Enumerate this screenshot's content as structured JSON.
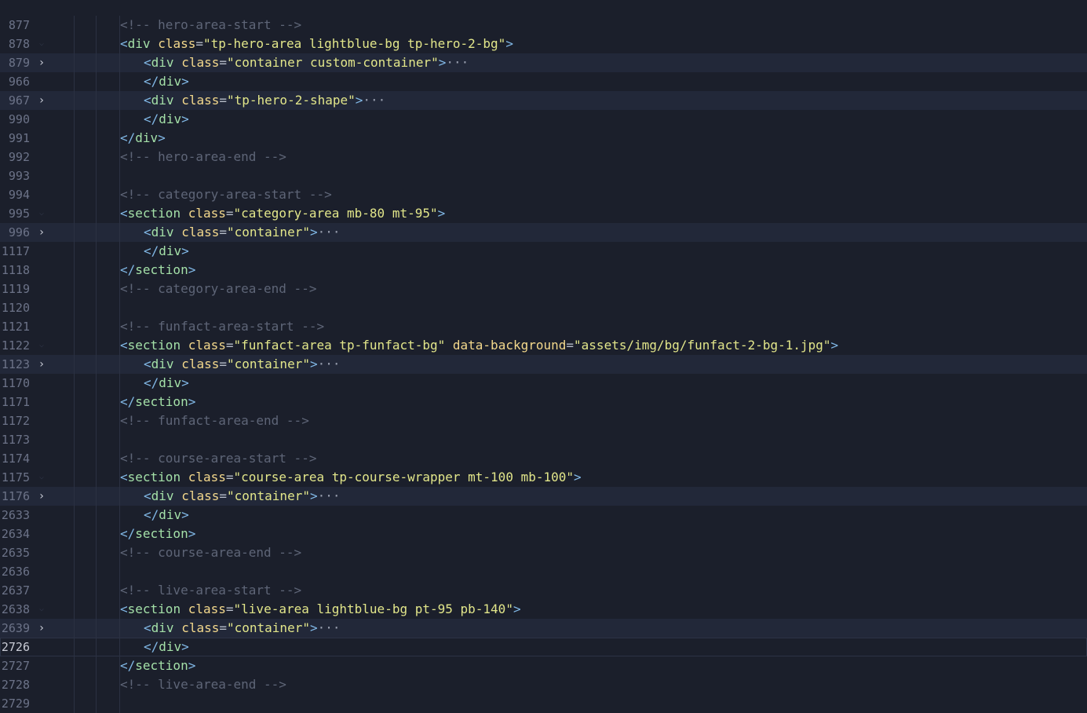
{
  "editor": {
    "lines": [
      {
        "num": "",
        "fold": "",
        "indent": 0,
        "tokens": []
      },
      {
        "num": "877",
        "fold": "",
        "indent": 3,
        "tokens": [
          {
            "c": "c",
            "t": "<!-- hero-area-start -->"
          }
        ]
      },
      {
        "num": "878",
        "fold": "open",
        "indent": 3,
        "tokens": [
          {
            "c": "b",
            "t": "<"
          },
          {
            "c": "t",
            "t": "div"
          },
          {
            "c": "p",
            "t": " "
          },
          {
            "c": "a",
            "t": "class"
          },
          {
            "c": "p",
            "t": "="
          },
          {
            "c": "s",
            "t": "\"tp-hero-area lightblue-bg tp-hero-2-bg\""
          },
          {
            "c": "b",
            "t": ">"
          }
        ]
      },
      {
        "num": "879",
        "fold": "closed",
        "indent": 4,
        "tokens": [
          {
            "c": "b",
            "t": "<"
          },
          {
            "c": "t",
            "t": "div"
          },
          {
            "c": "p",
            "t": " "
          },
          {
            "c": "a",
            "t": "class"
          },
          {
            "c": "p",
            "t": "="
          },
          {
            "c": "s",
            "t": "\"container custom-container\""
          },
          {
            "c": "b",
            "t": ">"
          },
          {
            "c": "el",
            "t": "···"
          }
        ]
      },
      {
        "num": "966",
        "fold": "",
        "indent": 4,
        "tokens": [
          {
            "c": "b",
            "t": "</"
          },
          {
            "c": "t",
            "t": "div"
          },
          {
            "c": "b",
            "t": ">"
          }
        ]
      },
      {
        "num": "967",
        "fold": "closed",
        "indent": 4,
        "tokens": [
          {
            "c": "b",
            "t": "<"
          },
          {
            "c": "t",
            "t": "div"
          },
          {
            "c": "p",
            "t": " "
          },
          {
            "c": "a",
            "t": "class"
          },
          {
            "c": "p",
            "t": "="
          },
          {
            "c": "s",
            "t": "\"tp-hero-2-shape\""
          },
          {
            "c": "b",
            "t": ">"
          },
          {
            "c": "el",
            "t": "···"
          }
        ]
      },
      {
        "num": "990",
        "fold": "",
        "indent": 4,
        "tokens": [
          {
            "c": "b",
            "t": "</"
          },
          {
            "c": "t",
            "t": "div"
          },
          {
            "c": "b",
            "t": ">"
          }
        ]
      },
      {
        "num": "991",
        "fold": "",
        "indent": 3,
        "tokens": [
          {
            "c": "b",
            "t": "</"
          },
          {
            "c": "t",
            "t": "div"
          },
          {
            "c": "b",
            "t": ">"
          }
        ]
      },
      {
        "num": "992",
        "fold": "",
        "indent": 3,
        "tokens": [
          {
            "c": "c",
            "t": "<!-- hero-area-end -->"
          }
        ]
      },
      {
        "num": "993",
        "fold": "",
        "indent": 3,
        "tokens": []
      },
      {
        "num": "994",
        "fold": "",
        "indent": 3,
        "tokens": [
          {
            "c": "c",
            "t": "<!-- category-area-start -->"
          }
        ]
      },
      {
        "num": "995",
        "fold": "open",
        "indent": 3,
        "tokens": [
          {
            "c": "b",
            "t": "<"
          },
          {
            "c": "t",
            "t": "section"
          },
          {
            "c": "p",
            "t": " "
          },
          {
            "c": "a",
            "t": "class"
          },
          {
            "c": "p",
            "t": "="
          },
          {
            "c": "s",
            "t": "\"category-area mb-80 mt-95\""
          },
          {
            "c": "b",
            "t": ">"
          }
        ]
      },
      {
        "num": "996",
        "fold": "closed",
        "indent": 4,
        "tokens": [
          {
            "c": "b",
            "t": "<"
          },
          {
            "c": "t",
            "t": "div"
          },
          {
            "c": "p",
            "t": " "
          },
          {
            "c": "a",
            "t": "class"
          },
          {
            "c": "p",
            "t": "="
          },
          {
            "c": "s",
            "t": "\"container\""
          },
          {
            "c": "b",
            "t": ">"
          },
          {
            "c": "el",
            "t": "···"
          }
        ]
      },
      {
        "num": "1117",
        "fold": "",
        "indent": 4,
        "tokens": [
          {
            "c": "b",
            "t": "</"
          },
          {
            "c": "t",
            "t": "div"
          },
          {
            "c": "b",
            "t": ">"
          }
        ]
      },
      {
        "num": "1118",
        "fold": "",
        "indent": 3,
        "tokens": [
          {
            "c": "b",
            "t": "</"
          },
          {
            "c": "t",
            "t": "section"
          },
          {
            "c": "b",
            "t": ">"
          }
        ]
      },
      {
        "num": "1119",
        "fold": "",
        "indent": 3,
        "tokens": [
          {
            "c": "c",
            "t": "<!-- category-area-end -->"
          }
        ]
      },
      {
        "num": "1120",
        "fold": "",
        "indent": 3,
        "tokens": []
      },
      {
        "num": "1121",
        "fold": "",
        "indent": 3,
        "tokens": [
          {
            "c": "c",
            "t": "<!-- funfact-area-start -->"
          }
        ]
      },
      {
        "num": "1122",
        "fold": "open",
        "indent": 3,
        "tokens": [
          {
            "c": "b",
            "t": "<"
          },
          {
            "c": "t",
            "t": "section"
          },
          {
            "c": "p",
            "t": " "
          },
          {
            "c": "a",
            "t": "class"
          },
          {
            "c": "p",
            "t": "="
          },
          {
            "c": "s",
            "t": "\"funfact-area tp-funfact-bg\""
          },
          {
            "c": "p",
            "t": " "
          },
          {
            "c": "a",
            "t": "data-background"
          },
          {
            "c": "p",
            "t": "="
          },
          {
            "c": "s",
            "t": "\"assets/img/bg/funfact-2-bg-1.jpg\""
          },
          {
            "c": "b",
            "t": ">"
          }
        ]
      },
      {
        "num": "1123",
        "fold": "closed",
        "indent": 4,
        "tokens": [
          {
            "c": "b",
            "t": "<"
          },
          {
            "c": "t",
            "t": "div"
          },
          {
            "c": "p",
            "t": " "
          },
          {
            "c": "a",
            "t": "class"
          },
          {
            "c": "p",
            "t": "="
          },
          {
            "c": "s",
            "t": "\"container\""
          },
          {
            "c": "b",
            "t": ">"
          },
          {
            "c": "el",
            "t": "···"
          }
        ]
      },
      {
        "num": "1170",
        "fold": "",
        "indent": 4,
        "tokens": [
          {
            "c": "b",
            "t": "</"
          },
          {
            "c": "t",
            "t": "div"
          },
          {
            "c": "b",
            "t": ">"
          }
        ]
      },
      {
        "num": "1171",
        "fold": "",
        "indent": 3,
        "tokens": [
          {
            "c": "b",
            "t": "</"
          },
          {
            "c": "t",
            "t": "section"
          },
          {
            "c": "b",
            "t": ">"
          }
        ]
      },
      {
        "num": "1172",
        "fold": "",
        "indent": 3,
        "tokens": [
          {
            "c": "c",
            "t": "<!-- funfact-area-end -->"
          }
        ]
      },
      {
        "num": "1173",
        "fold": "",
        "indent": 3,
        "tokens": []
      },
      {
        "num": "1174",
        "fold": "",
        "indent": 3,
        "tokens": [
          {
            "c": "c",
            "t": "<!-- course-area-start -->"
          }
        ]
      },
      {
        "num": "1175",
        "fold": "open",
        "indent": 3,
        "tokens": [
          {
            "c": "b",
            "t": "<"
          },
          {
            "c": "t",
            "t": "section"
          },
          {
            "c": "p",
            "t": " "
          },
          {
            "c": "a",
            "t": "class"
          },
          {
            "c": "p",
            "t": "="
          },
          {
            "c": "s",
            "t": "\"course-area tp-course-wrapper mt-100 mb-100\""
          },
          {
            "c": "b",
            "t": ">"
          }
        ]
      },
      {
        "num": "1176",
        "fold": "closed",
        "indent": 4,
        "tokens": [
          {
            "c": "b",
            "t": "<"
          },
          {
            "c": "t",
            "t": "div"
          },
          {
            "c": "p",
            "t": " "
          },
          {
            "c": "a",
            "t": "class"
          },
          {
            "c": "p",
            "t": "="
          },
          {
            "c": "s",
            "t": "\"container\""
          },
          {
            "c": "b",
            "t": ">"
          },
          {
            "c": "el",
            "t": "···"
          }
        ]
      },
      {
        "num": "2633",
        "fold": "",
        "indent": 4,
        "tokens": [
          {
            "c": "b",
            "t": "</"
          },
          {
            "c": "t",
            "t": "div"
          },
          {
            "c": "b",
            "t": ">"
          }
        ]
      },
      {
        "num": "2634",
        "fold": "",
        "indent": 3,
        "tokens": [
          {
            "c": "b",
            "t": "</"
          },
          {
            "c": "t",
            "t": "section"
          },
          {
            "c": "b",
            "t": ">"
          }
        ]
      },
      {
        "num": "2635",
        "fold": "",
        "indent": 3,
        "tokens": [
          {
            "c": "c",
            "t": "<!-- course-area-end -->"
          }
        ]
      },
      {
        "num": "2636",
        "fold": "",
        "indent": 3,
        "tokens": []
      },
      {
        "num": "2637",
        "fold": "",
        "indent": 3,
        "tokens": [
          {
            "c": "c",
            "t": "<!-- live-area-start -->"
          }
        ]
      },
      {
        "num": "2638",
        "fold": "open",
        "indent": 3,
        "tokens": [
          {
            "c": "b",
            "t": "<"
          },
          {
            "c": "t",
            "t": "section"
          },
          {
            "c": "p",
            "t": " "
          },
          {
            "c": "a",
            "t": "class"
          },
          {
            "c": "p",
            "t": "="
          },
          {
            "c": "s",
            "t": "\"live-area lightblue-bg pt-95 pb-140\""
          },
          {
            "c": "b",
            "t": ">"
          }
        ]
      },
      {
        "num": "2639",
        "fold": "closed",
        "indent": 4,
        "tokens": [
          {
            "c": "b",
            "t": "<"
          },
          {
            "c": "t",
            "t": "div"
          },
          {
            "c": "p",
            "t": " "
          },
          {
            "c": "a",
            "t": "class"
          },
          {
            "c": "p",
            "t": "="
          },
          {
            "c": "s",
            "t": "\"container\""
          },
          {
            "c": "b",
            "t": ">"
          },
          {
            "c": "el",
            "t": "···"
          }
        ]
      },
      {
        "num": "2726",
        "fold": "",
        "indent": 4,
        "current": true,
        "tokens": [
          {
            "c": "b",
            "t": "</"
          },
          {
            "c": "t",
            "t": "div"
          },
          {
            "c": "b",
            "t": ">"
          }
        ]
      },
      {
        "num": "2727",
        "fold": "",
        "indent": 3,
        "tokens": [
          {
            "c": "b",
            "t": "</"
          },
          {
            "c": "t",
            "t": "section"
          },
          {
            "c": "b",
            "t": ">"
          }
        ]
      },
      {
        "num": "2728",
        "fold": "",
        "indent": 3,
        "tokens": [
          {
            "c": "c",
            "t": "<!-- live-area-end -->"
          }
        ]
      },
      {
        "num": "2729",
        "fold": "",
        "indent": 3,
        "tokens": []
      }
    ]
  }
}
